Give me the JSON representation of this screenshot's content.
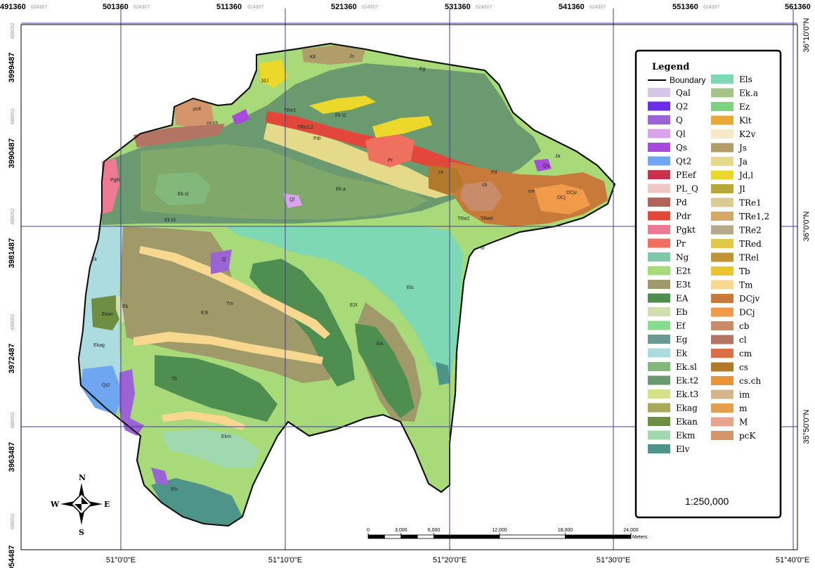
{
  "grid": {
    "top_labels": [
      {
        "main": "491360",
        "sub": "624307"
      },
      {
        "main": "501360",
        "sub": "624307"
      },
      {
        "main": "511360",
        "sub": "624307"
      },
      {
        "main": "521360",
        "sub": "624307"
      },
      {
        "main": "531360",
        "sub": "624307"
      },
      {
        "main": "541360",
        "sub": "624307"
      },
      {
        "main": "551360",
        "sub": "624307"
      },
      {
        "main": "561360",
        "sub": "624307"
      }
    ],
    "left_labels": [
      {
        "main": "3999487",
        "sub": "488052"
      },
      {
        "main": "3990487",
        "sub": "488052"
      },
      {
        "main": "3981487",
        "sub": "488052"
      },
      {
        "main": "3972487",
        "sub": "488052"
      },
      {
        "main": "3963487",
        "sub": "488052"
      },
      {
        "main": "954487",
        "sub": "488052"
      }
    ],
    "bottom_labels": [
      "51°0'0\"E",
      "51°10'0\"E",
      "51°20'0\"E",
      "51°30'0\"E",
      "51°40'0\"E"
    ],
    "right_labels": [
      "36°10'0\"N",
      "36°0'0\"N",
      "35°50'0\"N"
    ]
  },
  "legend": {
    "title": "Legend",
    "boundary_label": "Boundary",
    "col1": [
      {
        "label": "Qal",
        "color": "#d6c6ea"
      },
      {
        "label": "Q2",
        "color": "#6a2ee8"
      },
      {
        "label": "Q",
        "color": "#9b63d3"
      },
      {
        "label": "Ql",
        "color": "#d9a4ec"
      },
      {
        "label": "Qs",
        "color": "#a84bdc"
      },
      {
        "label": "Qt2",
        "color": "#6fa6f2"
      },
      {
        "label": "PEef",
        "color": "#c8324b"
      },
      {
        "label": "PL_Q",
        "color": "#f1c6c6"
      },
      {
        "label": "Pd",
        "color": "#b2645a"
      },
      {
        "label": "Pdr",
        "color": "#e3473a"
      },
      {
        "label": "Pgkt",
        "color": "#ec7a92"
      },
      {
        "label": "Pr",
        "color": "#f07060"
      },
      {
        "label": "Ng",
        "color": "#7cc8a8"
      },
      {
        "label": "E2t",
        "color": "#a9da7a"
      },
      {
        "label": "E3t",
        "color": "#a09a6a"
      },
      {
        "label": "EA",
        "color": "#4e8e50"
      },
      {
        "label": "Eb",
        "color": "#cfe0ae"
      },
      {
        "label": "Ef",
        "color": "#88dc90"
      },
      {
        "label": "Eg",
        "color": "#6a9a92"
      },
      {
        "label": "Ek",
        "color": "#acdce0"
      },
      {
        "label": "Ek.sl",
        "color": "#82b87a"
      },
      {
        "label": "Ek.t2",
        "color": "#6a9a6e"
      },
      {
        "label": "Ek.t3",
        "color": "#d4e08a"
      },
      {
        "label": "Ekag",
        "color": "#a8aa5a"
      },
      {
        "label": "Ekan",
        "color": "#6e8e42"
      },
      {
        "label": "Ekm",
        "color": "#a0d8b0"
      },
      {
        "label": "Elv",
        "color": "#4e9488"
      }
    ],
    "col2": [
      {
        "label": "Els",
        "color": "#7ed8b4"
      },
      {
        "label": "Ek.a",
        "color": "#a6c48a"
      },
      {
        "label": "Ez",
        "color": "#7ed282"
      },
      {
        "label": "Klt",
        "color": "#e8a83a"
      },
      {
        "label": "K2v",
        "color": "#f7e8c8"
      },
      {
        "label": "Js",
        "color": "#b09e6a"
      },
      {
        "label": "Ja",
        "color": "#e4da8a"
      },
      {
        "label": "Jd,l",
        "color": "#ecd82a"
      },
      {
        "label": "Jl",
        "color": "#b8a83a"
      },
      {
        "label": "TRe1",
        "color": "#d8cc94"
      },
      {
        "label": "TRe1,2",
        "color": "#d4aa62"
      },
      {
        "label": "TRe2",
        "color": "#b4aa8a"
      },
      {
        "label": "TRed",
        "color": "#e2c84a"
      },
      {
        "label": "TRel",
        "color": "#c09434"
      },
      {
        "label": "Tb",
        "color": "#ecc430"
      },
      {
        "label": "Tm",
        "color": "#f8d88e"
      },
      {
        "label": "DCjv",
        "color": "#c87a3a"
      },
      {
        "label": "DCj",
        "color": "#f09a4a"
      },
      {
        "label": "cb",
        "color": "#c88c6a"
      },
      {
        "label": "cl",
        "color": "#b47464"
      },
      {
        "label": "cm",
        "color": "#d8704a"
      },
      {
        "label": "cs",
        "color": "#b07a2a"
      },
      {
        "label": "cs.ch",
        "color": "#e89438"
      },
      {
        "label": "im",
        "color": "#d4b48a"
      },
      {
        "label": "m",
        "color": "#e4a050"
      },
      {
        "label": "M",
        "color": "#e8a48a"
      },
      {
        "label": "pcK",
        "color": "#d4956a"
      }
    ],
    "scale_text": "1:250,000"
  },
  "scale_bar": {
    "ticks": [
      "0",
      "3,000",
      "6,000",
      "12,000",
      "18,000",
      "24,000"
    ],
    "unit": "Meters"
  },
  "compass": {
    "n": "N",
    "s": "S",
    "e": "E",
    "w": "W"
  },
  "map_labels": [
    "Klt",
    "Js",
    "Eg",
    "Jd,l",
    "TRe1",
    "Ek.t2",
    "pcK",
    "cs.ch",
    "TRe1,2",
    "Pdr",
    "Pr",
    "cs",
    "Pd",
    "DCjv",
    "DCj",
    "cm",
    "Ek.a",
    "Ek.sl",
    "Ek.t3",
    "Pgkt",
    "Ql",
    "Qs",
    "E2t",
    "E3t",
    "Els",
    "EA",
    "Tm",
    "Tb",
    "Ek",
    "Ekan",
    "Ekag",
    "Qt2",
    "Ekm",
    "Elv",
    "Q",
    "TRe2",
    "TRed",
    "M",
    "cb",
    "Ja",
    "Eb"
  ]
}
